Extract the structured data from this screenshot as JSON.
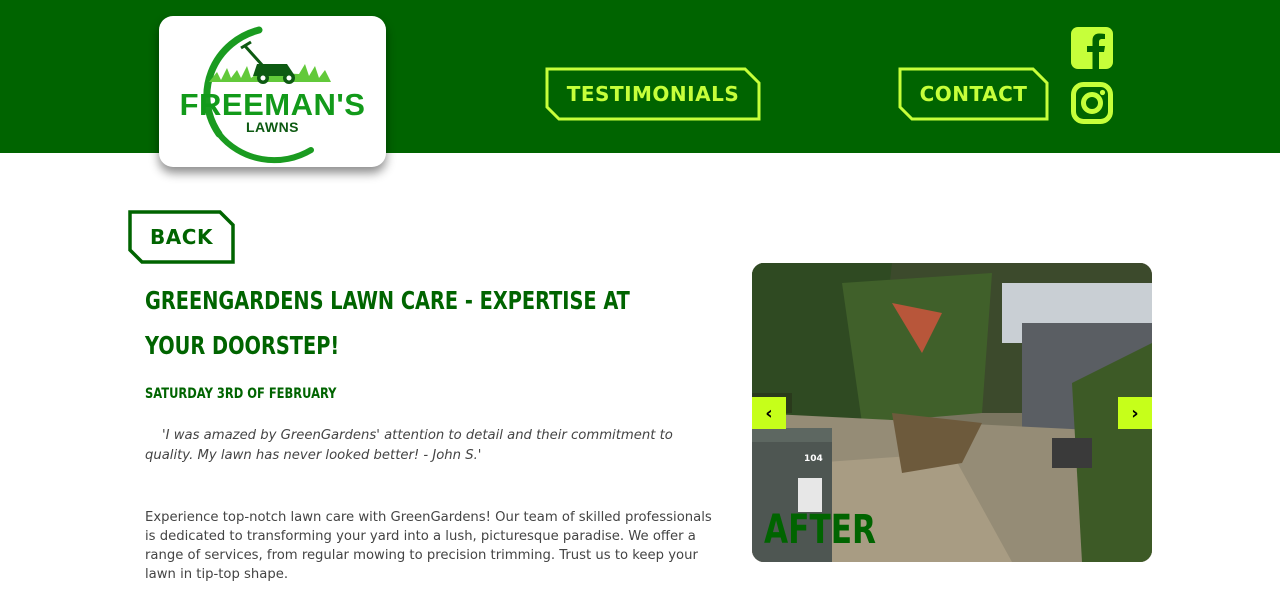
{
  "logo": {
    "title": "FREEMAN'S",
    "subtitle": "LAWNS"
  },
  "nav": {
    "testimonials_label": "TESTIMONIALS",
    "contact_label": "CONTACT"
  },
  "social": {
    "facebook_icon": "facebook-icon",
    "instagram_icon": "instagram-icon"
  },
  "back_label": "BACK",
  "article": {
    "title": "GreenGardens Lawn Care - Expertise at Your Doorstep!",
    "date": "Saturday 3rd of February",
    "quote": "'I was amazed by GreenGardens' attention to detail and their commitment to quality. My lawn has never looked better! - John S.'",
    "body": "Experience top-notch lawn care with GreenGardens! Our team of skilled professionals is dedicated to transforming your yard into a lush, picturesque paradise. We offer a range of services, from regular mowing to precision trimming. Trust us to keep your lawn in tip-top shape."
  },
  "carousel": {
    "label": "AFTER",
    "bin_number": "104",
    "prev_symbol": "‹",
    "next_symbol": "›"
  },
  "colors": {
    "header_green": "#006400",
    "accent_lime": "#c6ff3a",
    "arrow_lime": "#c6ff1a",
    "text_gray": "#444444"
  }
}
